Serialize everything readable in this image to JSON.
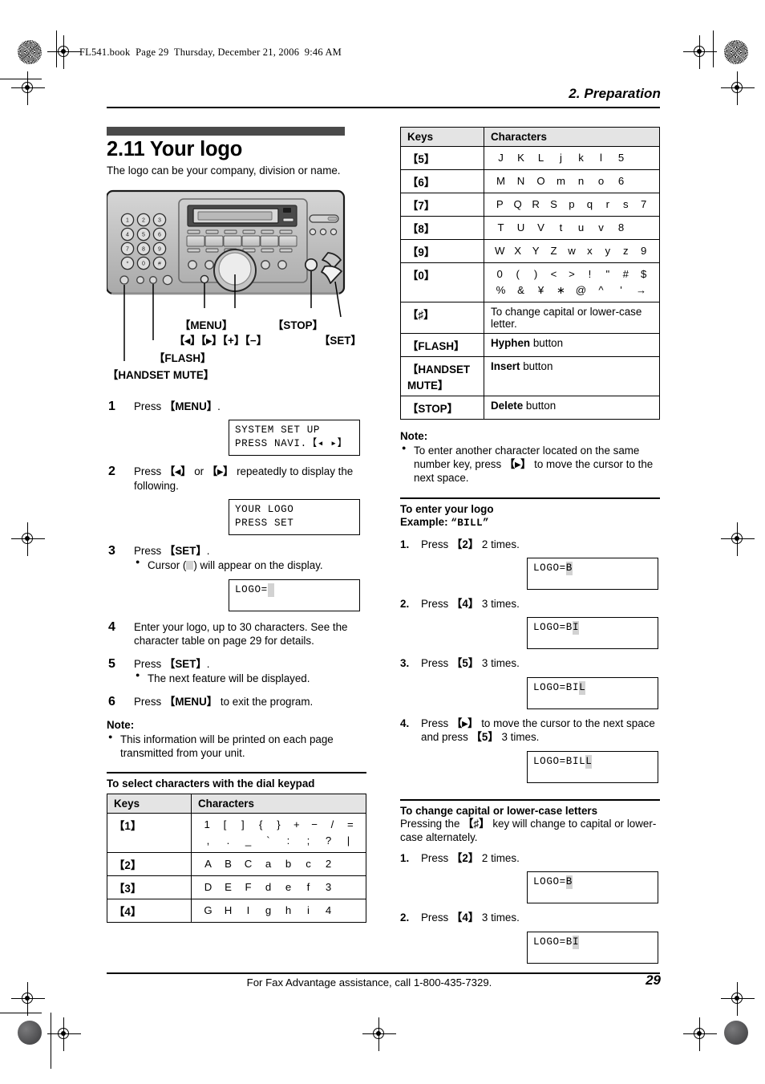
{
  "header": {
    "book_info": "FL541.book  Page 29  Thursday, December 21, 2006  9:46 AM",
    "chapter": "2. Preparation"
  },
  "section": {
    "title": "2.11 Your logo",
    "description": "The logo can be your company, division or name."
  },
  "diagram": {
    "labels": {
      "menu": "【MENU】",
      "stop": "【STOP】",
      "navi": "【◂】【▸】【+】【−】",
      "set": "【SET】",
      "flash": "【FLASH】",
      "handset_mute": "【HANDSET MUTE】"
    }
  },
  "steps": [
    {
      "num": "1",
      "text": "Press ",
      "key": "【MENU】",
      "tail": ".",
      "display": {
        "line1": "SYSTEM SET UP",
        "line2": "PRESS NAVI.【◂ ▸】"
      }
    },
    {
      "num": "2",
      "text_pre": "Press ",
      "key1": "【◂】",
      "mid": " or ",
      "key2": "【▸】",
      "tail": " repeatedly to display the following.",
      "display": {
        "line1": "YOUR LOGO",
        "line2": "PRESS SET"
      }
    },
    {
      "num": "3",
      "text": "Press ",
      "key": "【SET】",
      "tail": ".",
      "bullet_pre": "Cursor (",
      "bullet_post": ") will appear on the display.",
      "display": {
        "prefix": "LOGO=",
        "cursor": " "
      }
    },
    {
      "num": "4",
      "text": "Enter your logo, up to 30 characters. See the character table on page 29 for details."
    },
    {
      "num": "5",
      "text": "Press ",
      "key": "【SET】",
      "tail": ".",
      "bullet": "The next feature will be displayed."
    },
    {
      "num": "6",
      "text_pre": "Press ",
      "key": "【MENU】",
      "tail": " to exit the program."
    }
  ],
  "note_left": {
    "title": "Note:",
    "bullet": "This information will be printed on each page transmitted from your unit."
  },
  "table_left": {
    "heading": "To select characters with the dial keypad",
    "columns": [
      "Keys",
      "Characters"
    ],
    "rows": [
      {
        "key": "【1】",
        "chars_line1": [
          "1",
          "[",
          "]",
          "{",
          "}",
          "+",
          "−",
          "/",
          "="
        ],
        "chars_line2": [
          ",",
          ".",
          "_",
          "`",
          ":",
          ";",
          "?",
          "|"
        ]
      },
      {
        "key": "【2】",
        "chars_line1": [
          "A",
          "B",
          "C",
          "a",
          "b",
          "c",
          "2"
        ]
      },
      {
        "key": "【3】",
        "chars_line1": [
          "D",
          "E",
          "F",
          "d",
          "e",
          "f",
          "3"
        ]
      },
      {
        "key": "【4】",
        "chars_line1": [
          "G",
          "H",
          "I",
          "g",
          "h",
          "i",
          "4"
        ]
      }
    ]
  },
  "table_right": {
    "columns": [
      "Keys",
      "Characters"
    ],
    "rows": [
      {
        "key": "【5】",
        "chars_line1": [
          "J",
          "K",
          "L",
          "j",
          "k",
          "l",
          "5"
        ]
      },
      {
        "key": "【6】",
        "chars_line1": [
          "M",
          "N",
          "O",
          "m",
          "n",
          "o",
          "6"
        ]
      },
      {
        "key": "【7】",
        "chars_line1": [
          "P",
          "Q",
          "R",
          "S",
          "p",
          "q",
          "r",
          "s",
          "7"
        ]
      },
      {
        "key": "【8】",
        "chars_line1": [
          "T",
          "U",
          "V",
          "t",
          "u",
          "v",
          "8"
        ]
      },
      {
        "key": "【9】",
        "chars_line1": [
          "W",
          "X",
          "Y",
          "Z",
          "w",
          "x",
          "y",
          "z",
          "9"
        ]
      },
      {
        "key": "【0】",
        "chars_line1": [
          "0",
          "(",
          ")",
          "<",
          ">",
          "!",
          "\"",
          "#",
          "$"
        ],
        "chars_line2": [
          "%",
          "&",
          "¥",
          "∗",
          "@",
          "^",
          "'",
          "→"
        ]
      },
      {
        "key": "【♯】",
        "text": "To change capital or lower-case letter."
      },
      {
        "key": "【FLASH】",
        "bold": "Hyphen",
        "rest": " button"
      },
      {
        "key": "【HANDSET\nMUTE】",
        "bold": "Insert",
        "rest": " button"
      },
      {
        "key": "【STOP】",
        "bold": "Delete",
        "rest": " button"
      }
    ]
  },
  "note_right": {
    "title": "Note:",
    "bullet_pre": "To enter another character located on the same number key, press ",
    "bullet_key": "【▸】",
    "bullet_post": " to move the cursor to the next space."
  },
  "enter_logo": {
    "heading": "To enter your logo",
    "example_label": "Example: ",
    "example_value": "“BILL”",
    "steps": [
      {
        "num": "1.",
        "pre": "Press ",
        "key": "【2】",
        "post": " 2 times.",
        "display": {
          "prefix": "LOGO=",
          "cursor": "B"
        }
      },
      {
        "num": "2.",
        "pre": "Press ",
        "key": "【4】",
        "post": " 3 times.",
        "display": {
          "prefix": "LOGO=B",
          "cursor": "I"
        }
      },
      {
        "num": "3.",
        "pre": "Press ",
        "key": "【5】",
        "post": " 3 times.",
        "display": {
          "prefix": "LOGO=BI",
          "cursor": "L"
        }
      },
      {
        "num": "4.",
        "pre": "Press ",
        "key": "【▸】",
        "post": " to move the cursor to the next space and press ",
        "key2": "【5】",
        "post2": " 3 times.",
        "display": {
          "prefix": "LOGO=BIL",
          "cursor": "L"
        }
      }
    ]
  },
  "change_case": {
    "heading": "To change capital or lower-case letters",
    "desc_pre": "Pressing the ",
    "desc_key": "【♯】",
    "desc_post": " key will change to capital or lower-case alternately.",
    "steps": [
      {
        "num": "1.",
        "pre": "Press ",
        "key": "【2】",
        "post": " 2 times.",
        "display": {
          "prefix": "LOGO=",
          "cursor": "B"
        }
      },
      {
        "num": "2.",
        "pre": "Press ",
        "key": "【4】",
        "post": " 3 times.",
        "display": {
          "prefix": "LOGO=B",
          "cursor": "I"
        }
      }
    ]
  },
  "footer": {
    "text": "For Fax Advantage assistance, call 1-800-435-7329.",
    "page": "29"
  },
  "colors": {
    "section_bar": "#4a4a4a",
    "table_header": "#e4e4e4",
    "cursor": "#d2d2d2"
  }
}
